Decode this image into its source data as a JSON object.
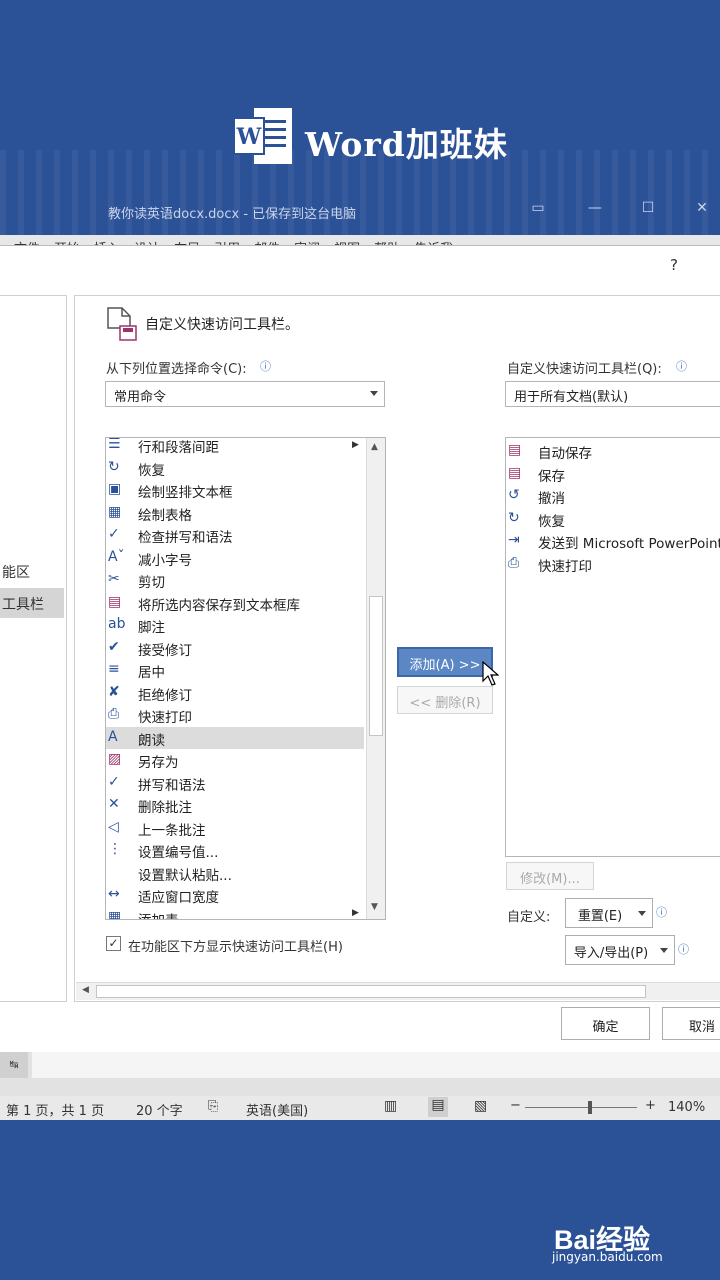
{
  "brand": {
    "name": "Word加班妹"
  },
  "window": {
    "title": "教你读英语docx.docx - 已保存到这台电脑"
  },
  "ribbon_tabs": [
    "文件",
    "开始",
    "插入",
    "设计",
    "布局",
    "引用",
    "邮件",
    "审阅",
    "视图",
    "帮助",
    "告诉我"
  ],
  "dialog": {
    "help": "?",
    "nav": [
      "能区",
      "工具栏"
    ],
    "title": "自定义快速访问工具栏。",
    "choose_label": "从下列位置选择命令(C):",
    "choose_value": "常用命令",
    "target_label": "自定义快速访问工具栏(Q):",
    "target_value": "用于所有文档(默认)",
    "commands": [
      {
        "icon": "paragraph-spacing-icon",
        "label": "行和段落间距"
      },
      {
        "icon": "redo-icon",
        "label": "恢复"
      },
      {
        "icon": "vertical-textbox-icon",
        "label": "绘制竖排文本框"
      },
      {
        "icon": "draw-table-icon",
        "label": "绘制表格"
      },
      {
        "icon": "spelling-check-icon",
        "label": "检查拼写和语法"
      },
      {
        "icon": "shrink-font-icon",
        "label": "减小字号"
      },
      {
        "icon": "cut-icon",
        "label": "剪切"
      },
      {
        "icon": "save-selection-icon",
        "label": "将所选内容保存到文本框库"
      },
      {
        "icon": "footnote-icon",
        "label": "脚注"
      },
      {
        "icon": "accept-revision-icon",
        "label": "接受修订"
      },
      {
        "icon": "center-align-icon",
        "label": "居中"
      },
      {
        "icon": "reject-revision-icon",
        "label": "拒绝修订"
      },
      {
        "icon": "quick-print-icon",
        "label": "快速打印"
      },
      {
        "icon": "read-aloud-icon",
        "label": "朗读"
      },
      {
        "icon": "save-as-icon",
        "label": "另存为"
      },
      {
        "icon": "spelling-grammar-icon",
        "label": "拼写和语法"
      },
      {
        "icon": "delete-comment-icon",
        "label": "删除批注"
      },
      {
        "icon": "previous-comment-icon",
        "label": "上一条批注"
      },
      {
        "icon": "numbering-value-icon",
        "label": "设置编号值..."
      },
      {
        "icon": "blank-icon",
        "label": "设置默认粘贴..."
      },
      {
        "icon": "fit-width-icon",
        "label": "适应窗口宽度"
      },
      {
        "icon": "add-table-icon",
        "label": "添加表"
      }
    ],
    "selected_command": "朗读",
    "qat_items": [
      {
        "icon": "autosave-icon",
        "label": "自动保存"
      },
      {
        "icon": "save-icon",
        "label": "保存"
      },
      {
        "icon": "undo-icon",
        "label": "撤消"
      },
      {
        "icon": "redo-icon",
        "label": "恢复"
      },
      {
        "icon": "send-to-icon",
        "label": "发送到 Microsoft PowerPoint"
      },
      {
        "icon": "quick-print-icon",
        "label": "快速打印"
      }
    ],
    "add_button": "添加(A) >>",
    "remove_button": "<< 删除(R)",
    "modify_button": "修改(M)...",
    "customize_label": "自定义:",
    "reset_button": "重置(E)",
    "import_export_button": "导入/导出(P)",
    "show_below_checkbox": "在功能区下方显示快速访问工具栏(H)",
    "ok_button": "确定",
    "cancel_button": "取消"
  },
  "status": {
    "page": "第 1 页，共 1 页",
    "words": "20 个字",
    "language": "英语(美国)",
    "zoom": "140%"
  },
  "watermark": {
    "name": "Bai经验",
    "url": "jingyan.baidu.com"
  }
}
